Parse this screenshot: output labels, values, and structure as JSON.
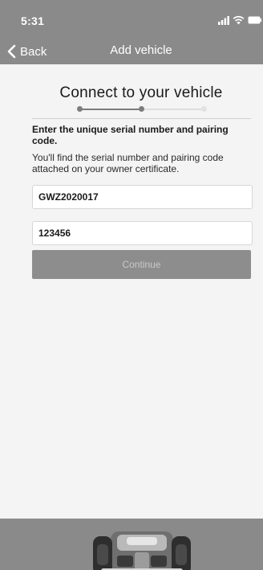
{
  "status_bar": {
    "time": "5:31",
    "icons": [
      "signal-icon",
      "wifi-icon",
      "battery-icon"
    ]
  },
  "nav": {
    "back_label": "Back",
    "back_icon": "chevron-left-icon",
    "title": "Add vehicle"
  },
  "main": {
    "title": "Connect to your vehicle",
    "stepper": {
      "total_steps": 3,
      "completed_steps": 2
    },
    "instruction_heading": "Enter the unique serial number and pairing code.",
    "instruction_body": "You'll find the serial number and pairing code attached on your owner certificate.",
    "serial_field": {
      "value": "GWZ2020017"
    },
    "pairing_field": {
      "value": "123456"
    },
    "continue_label": "Continue"
  },
  "bottom": {
    "image": "robotic-mower-image"
  },
  "colors": {
    "header_bg": "#8a8a8a",
    "page_bg": "#f4f4f4",
    "button_bg": "#8d8d8d",
    "button_text": "#c9c9c9",
    "step_active": "#7c7c7c",
    "step_inactive": "#e2e2e2"
  }
}
